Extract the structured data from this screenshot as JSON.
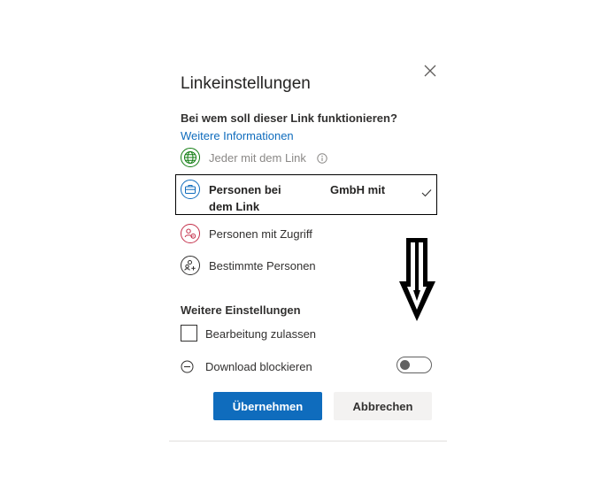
{
  "dialog": {
    "title": "Linkeinstellungen",
    "question": "Bei wem soll dieser Link funktionieren?",
    "more_info_link": "Weitere Informationen",
    "options": [
      {
        "label": "Jeder mit dem Link",
        "icon": "globe-icon",
        "state": "disabled"
      },
      {
        "label_line1": "Personen bei",
        "label_line2": "dem Link",
        "org_text": "GmbH mit",
        "icon": "briefcase-icon",
        "state": "selected"
      },
      {
        "label": "Personen mit Zugriff",
        "icon": "people-access-icon",
        "state": "normal"
      },
      {
        "label": "Bestimmte Personen",
        "icon": "specific-people-icon",
        "state": "normal"
      }
    ],
    "more_settings_title": "Weitere Einstellungen",
    "allow_editing_label": "Bearbeitung zulassen",
    "allow_editing_checked": false,
    "block_download_label": "Download blockieren",
    "block_download_on": false,
    "apply_button": "Übernehmen",
    "cancel_button": "Abbrechen"
  },
  "colors": {
    "accent": "#0f6cbd",
    "globe_icon": "#107c10",
    "selected_icon": "#0f6cbd",
    "access_icon": "#c4314b",
    "annotation_arrow": "#000000"
  }
}
